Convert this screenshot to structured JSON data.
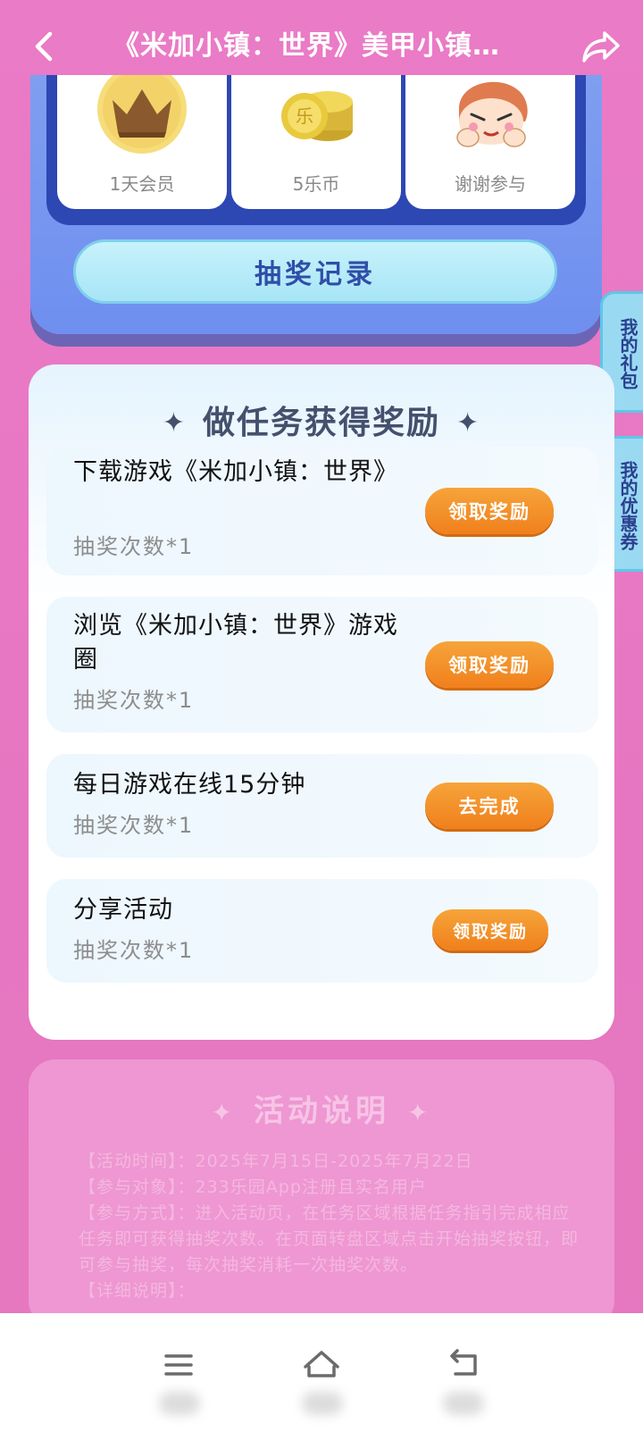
{
  "header": {
    "title": "《米加小镇：世界》美甲小镇…"
  },
  "prizes": [
    {
      "label": "1天会员",
      "icon": "crown-icon"
    },
    {
      "label": "5乐币",
      "icon": "coin-stack-icon"
    },
    {
      "label": "谢谢参与",
      "icon": "mascot-icon"
    }
  ],
  "record_button": "抽奖记录",
  "side_tabs": {
    "gift": "我的礼包",
    "coupon": "我的优惠券"
  },
  "tasks": {
    "title": "做任务获得奖励",
    "spark": "✦",
    "items": [
      {
        "name": "下载游戏《米加小镇：世界》",
        "count": "抽奖次数*1",
        "button": "领取奖励"
      },
      {
        "name": "浏览《米加小镇：世界》游戏圈",
        "count": "抽奖次数*1",
        "button": "领取奖励"
      },
      {
        "name": "每日游戏在线15分钟",
        "count": "抽奖次数*1",
        "button": "去完成"
      },
      {
        "name": "分享活动",
        "count": "抽奖次数*1",
        "button": "领取奖励"
      }
    ]
  },
  "rules": {
    "title": "活动说明",
    "lines": [
      "【活动时间】：2025年7月15日-2025年7月22日",
      "【参与对象】：233乐园App注册且实名用户",
      "【参与方式】：进入活动页，在任务区域根据任务指引完成相应任务即可获得抽奖次数。在页面转盘区域点击开始抽奖按钮，即可参与抽奖，每次抽奖消耗一次抽奖次数。",
      "【详细说明】："
    ]
  },
  "colors": {
    "background": "#e77dc3",
    "panel_blue": "#6f8ff0",
    "button_orange": "#f0801c",
    "record_button": "#b4eaf8"
  }
}
